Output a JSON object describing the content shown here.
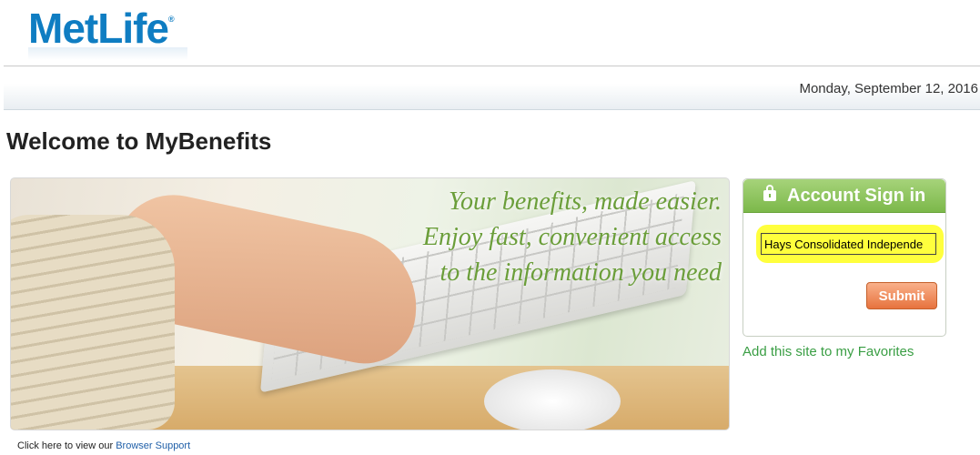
{
  "header": {
    "logo_text": "MetLife",
    "logo_reg": "®",
    "date": "Monday, September 12, 2016"
  },
  "main": {
    "title": "Welcome to MyBenefits",
    "hero": {
      "tagline_line1": "Your benefits, made easier.",
      "tagline_line2": "Enjoy fast, convenient access",
      "tagline_line3": "to the information you need"
    }
  },
  "signin": {
    "heading": "Account Sign in",
    "company_input_value": "Hays Consolidated Independe",
    "submit_label": "Submit",
    "favorites_link": "Add this site to my Favorites"
  },
  "footer": {
    "text": "Click here to view our ",
    "link": "Browser Support"
  },
  "colors": {
    "brand_blue": "#0f7dc2",
    "accent_green": "#7cb84a",
    "submit_orange": "#e7733e",
    "highlight_yellow": "#ffff33"
  }
}
